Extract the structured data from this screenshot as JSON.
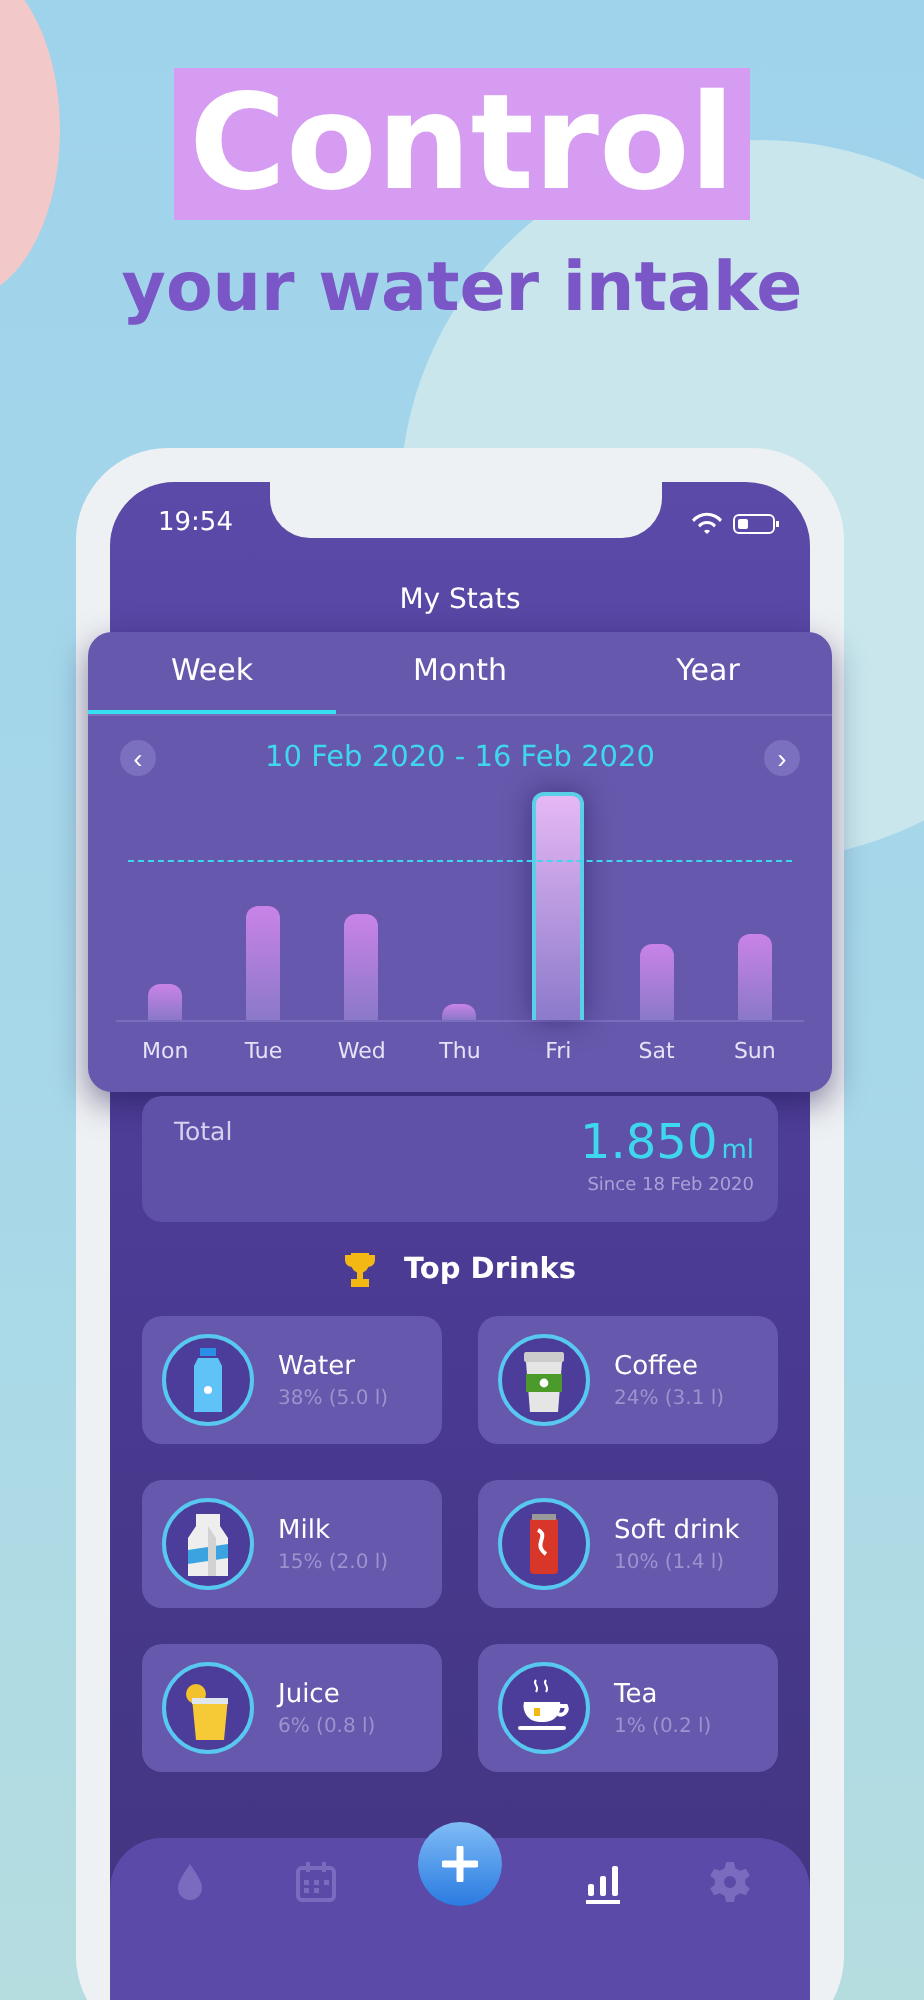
{
  "headline": {
    "title": "Control",
    "subtitle": "your water intake"
  },
  "status_bar": {
    "time": "19:54"
  },
  "screen_title": "My Stats",
  "tabs": [
    {
      "label": "Week",
      "selected": true
    },
    {
      "label": "Month",
      "selected": false
    },
    {
      "label": "Year",
      "selected": false
    }
  ],
  "period": {
    "prev": "‹",
    "label": "10 Feb 2020 - 16 Feb 2020",
    "next": "›"
  },
  "days": [
    {
      "label": "Mon",
      "selected": false
    },
    {
      "label": "Tue",
      "selected": false
    },
    {
      "label": "Wed",
      "selected": false
    },
    {
      "label": "Thu",
      "selected": false
    },
    {
      "label": "Fri",
      "selected": true
    },
    {
      "label": "Sat",
      "selected": false
    },
    {
      "label": "Sun",
      "selected": false
    }
  ],
  "total": {
    "label": "Total",
    "value": "1.850",
    "unit": "ml",
    "since": "Since 18 Feb 2020"
  },
  "top_drinks": {
    "title": "Top Drinks",
    "items": [
      {
        "name": "Water",
        "share": "38% (5.0 l)"
      },
      {
        "name": "Coffee",
        "share": "24% (3.1 l)"
      },
      {
        "name": "Milk",
        "share": "15% (2.0 l)"
      },
      {
        "name": "Soft drink",
        "share": "10% (1.4 l)"
      },
      {
        "name": "Juice",
        "share": "6% (0.8 l)"
      },
      {
        "name": "Tea",
        "share": "1% (0.2 l)"
      }
    ]
  },
  "nav": [
    {
      "selected": false
    },
    {
      "selected": false
    },
    {
      "selected": true
    },
    {
      "selected": false
    }
  ]
}
